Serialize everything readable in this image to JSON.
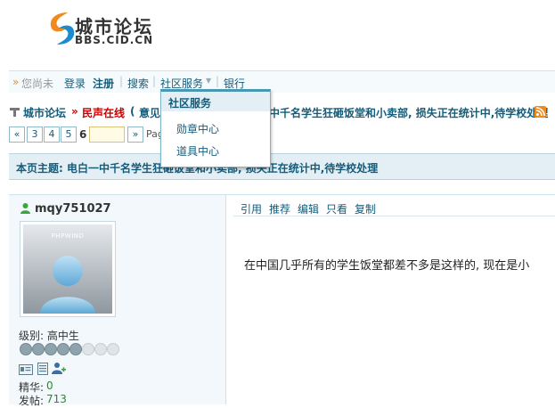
{
  "logo": {
    "cn": "城市论坛",
    "en": "BBS.CID.CN",
    "colors": {
      "orange": "#f08a1c",
      "blue": "#1b8bd0"
    }
  },
  "nav": {
    "prefix": "»",
    "not_logged_in": "您尚未",
    "login": "登录",
    "register": "注册",
    "search": "搜索",
    "community": "社区服务",
    "bank": "银行"
  },
  "dropdown": {
    "title": "社区服务",
    "items": [
      "勋章中心",
      "道具中心"
    ]
  },
  "breadcrumb": {
    "forum": "城市论坛",
    "board": "民声在线",
    "bracket": "(",
    "title_prefix": "意见",
    "title_rest": "中千名学生狂砸饭堂和小卖部, 损失正在统计中,待学校处理"
  },
  "pagination": {
    "prev": "«",
    "pages": [
      "3",
      "4",
      "5"
    ],
    "current": "6",
    "next": "»",
    "label": "Pag"
  },
  "topic": {
    "label": "本页主题: 电白一中千名学生狂砸饭堂和小卖部, 损失正在统计中,待学校处理"
  },
  "user": {
    "name": "mqy751027",
    "avatar_text": "PHPWIND",
    "level_label": "级别: 高中生",
    "essence_label": "精华:",
    "essence_value": "0",
    "posts_label": "发帖:",
    "posts_value": "713",
    "filled_stars": 5,
    "total_stars": 8
  },
  "actions": [
    "引用",
    "推荐",
    "编辑",
    "只看",
    "复制"
  ],
  "content": {
    "text": "在中国几乎所有的学生饭堂都差不多是这样的, 现在是小"
  },
  "colors": {
    "link_blue": "#145c7a",
    "red": "#cc0000",
    "nav_gray": "#999999",
    "green": "#2a8a2a"
  }
}
